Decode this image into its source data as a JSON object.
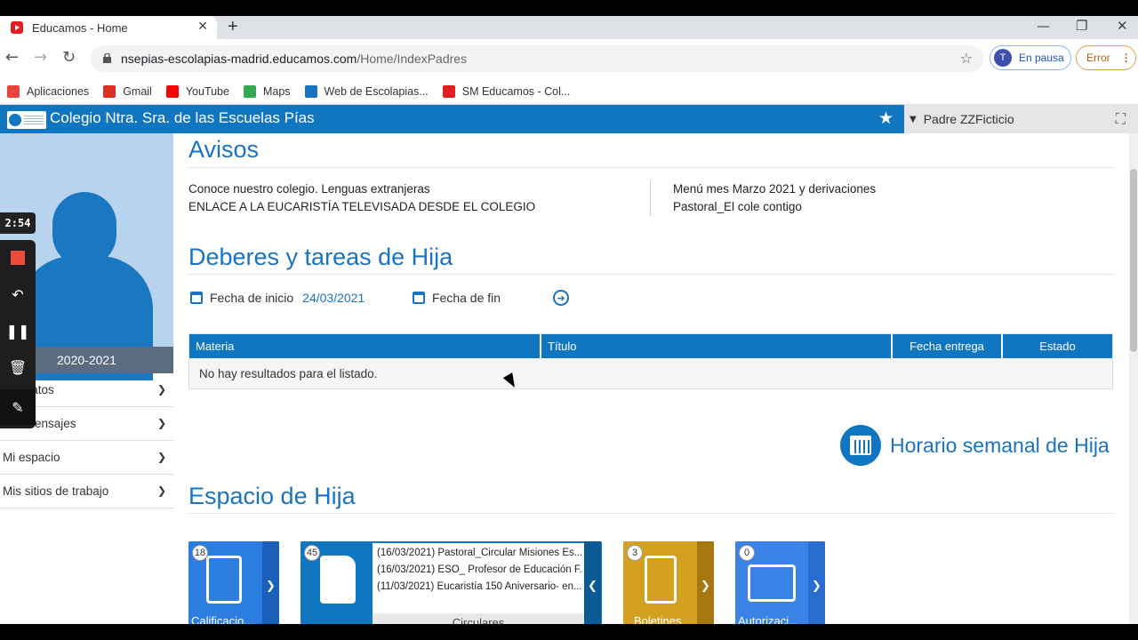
{
  "browser": {
    "tab_title": "Educamos - Home",
    "url_host": "nsepias-escolapias-madrid.educamos.com",
    "url_path": "/Home/IndexPadres",
    "profile_initial": "T",
    "profile_label": "En pausa",
    "error_label": "Error",
    "bookmarks": [
      {
        "label": "Aplicaciones",
        "icon": "apps-grid-icon",
        "color": "#e8453c"
      },
      {
        "label": "Gmail",
        "icon": "gmail-icon",
        "color": "#d93025"
      },
      {
        "label": "YouTube",
        "icon": "youtube-icon",
        "color": "#ff0000"
      },
      {
        "label": "Maps",
        "icon": "maps-icon",
        "color": "#34a853"
      },
      {
        "label": "Web de Escolapias...",
        "icon": "edge-e-icon",
        "color": "#1a73c0"
      },
      {
        "label": "SM Educamos - Col...",
        "icon": "educamos-icon",
        "color": "#e02020"
      }
    ]
  },
  "app": {
    "title": "Colegio Ntra. Sra. de las Escuelas Pías",
    "user": "Padre ZZFicticio",
    "accent": "#1076c0"
  },
  "sidebar": {
    "year": "2020-2021",
    "items": [
      {
        "label": "Mis datos"
      },
      {
        "label": "Mis mensajes"
      },
      {
        "label": "Mi espacio"
      },
      {
        "label": "Mis sitios de trabajo"
      }
    ]
  },
  "recorder": {
    "time": "2:54"
  },
  "avisos": {
    "title": "Avisos",
    "left": [
      "Conoce nuestro colegio. Lenguas extranjeras",
      "ENLACE A LA EUCARISTÍA TELEVISADA DESDE EL COLEGIO"
    ],
    "right": [
      "Menú mes Marzo 2021 y derivaciones",
      "Pastoral_El cole contigo"
    ]
  },
  "deberes": {
    "title": "Deberes y tareas de Hija",
    "start_label": "Fecha de inicio",
    "start_value": "24/03/2021",
    "end_label": "Fecha de fin",
    "columns": [
      "Materia",
      "Título",
      "Fecha entrega",
      "Estado"
    ],
    "empty_text": "No hay resultados para el listado."
  },
  "horario": {
    "label": "Horario semanal de Hija"
  },
  "espacio": {
    "title": "Espacio de Hija",
    "tiles": [
      {
        "label": "Calificacio...",
        "count": "18",
        "color": "#2b7de0"
      },
      {
        "label": "Circulares",
        "count": "45",
        "color": "#1076c0",
        "items": [
          "(16/03/2021) Pastoral_Circular Misiones Es...",
          "(16/03/2021) ESO_ Profesor de Educación F...",
          "(11/03/2021) Eucaristía 150 Aniversario- en..."
        ]
      },
      {
        "label": "Boletines",
        "count": "3",
        "color": "#d4a020"
      },
      {
        "label": "Autorizaci...",
        "count": "0",
        "color": "#3b82e6"
      }
    ]
  }
}
